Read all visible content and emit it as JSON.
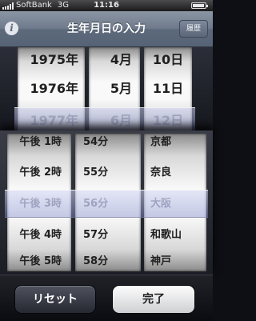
{
  "status_bar": {
    "carrier": "SoftBank",
    "network": "3G",
    "time": "11:16",
    "battery_level": 0.9
  },
  "nav": {
    "title": "生年月日の入力",
    "info_icon": "info-icon",
    "history_button": "履歴"
  },
  "date_picker": {
    "years": [
      "1975年",
      "1976年",
      "1977年"
    ],
    "months": [
      "4月",
      "5月",
      "6月"
    ],
    "days": [
      "10日",
      "11日",
      "12日"
    ],
    "selected": {
      "year": "1977年",
      "month": "6月",
      "day": "12日"
    }
  },
  "time_place_picker": {
    "hours": [
      "午後 1時",
      "午後 2時",
      "午後 3時",
      "午後 4時",
      "午後 5時"
    ],
    "minutes": [
      "54分",
      "55分",
      "56分",
      "57分",
      "58分"
    ],
    "places": [
      "京都",
      "奈良",
      "大阪",
      "和歌山",
      "神戸"
    ],
    "selected": {
      "hour": "午後 3時",
      "minute": "56分",
      "place": "大阪"
    }
  },
  "toolbar": {
    "reset_label": "リセット",
    "done_label": "完了"
  }
}
